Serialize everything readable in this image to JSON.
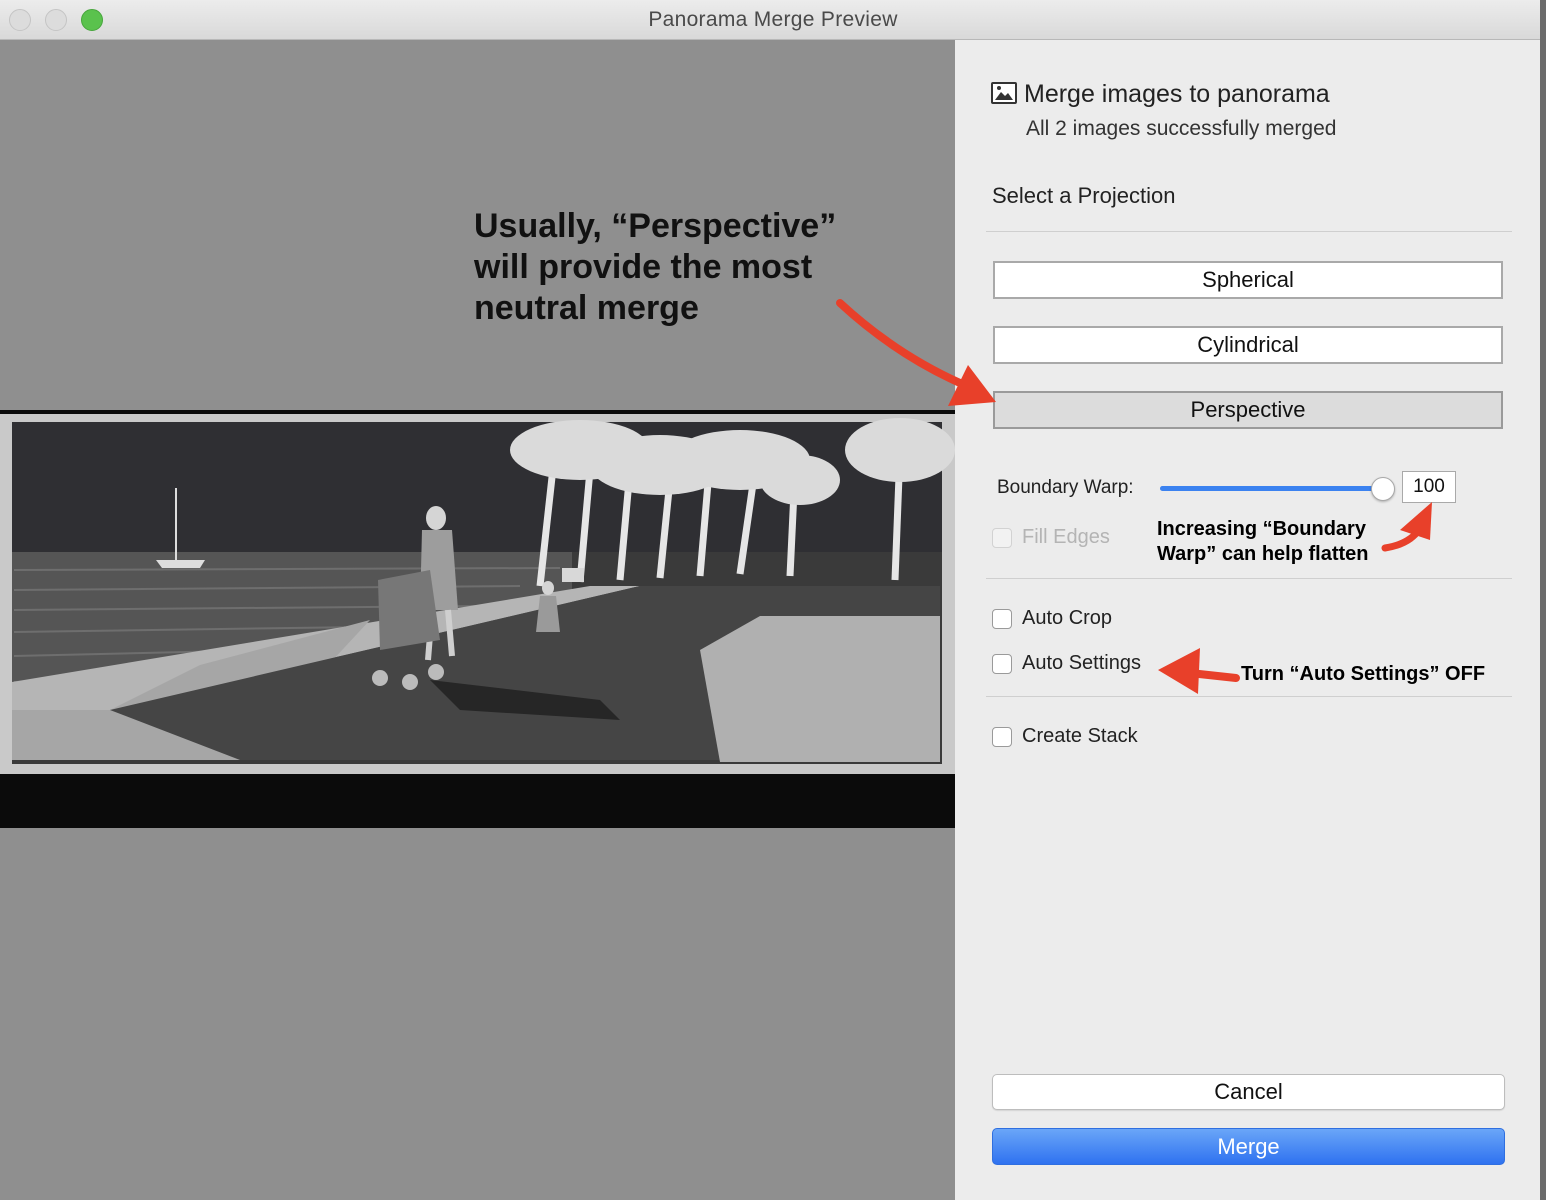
{
  "window": {
    "title": "Panorama Merge Preview"
  },
  "header": {
    "title": "Merge images to panorama",
    "subtitle": "All 2 images successfully merged"
  },
  "projection": {
    "section_label": "Select a Projection",
    "options": [
      "Spherical",
      "Cylindrical",
      "Perspective"
    ],
    "selected": "Perspective"
  },
  "boundary_warp": {
    "label": "Boundary Warp:",
    "value": "100",
    "level": 100,
    "max": 100
  },
  "checkboxes": {
    "fill_edges": {
      "label": "Fill Edges",
      "checked": false,
      "enabled": false
    },
    "auto_crop": {
      "label": "Auto Crop",
      "checked": false,
      "enabled": true
    },
    "auto_settings": {
      "label": "Auto Settings",
      "checked": false,
      "enabled": true
    },
    "create_stack": {
      "label": "Create Stack",
      "checked": false,
      "enabled": true
    }
  },
  "buttons": {
    "cancel": "Cancel",
    "merge": "Merge"
  },
  "annotations": {
    "perspective_line1": "Usually, “Perspective”",
    "perspective_line2": "will provide the most",
    "perspective_line3": "neutral merge",
    "boundary_line1": "Increasing “Boundary",
    "boundary_line2": "Warp” can help flatten",
    "auto_settings": "Turn “Auto Settings” OFF"
  },
  "colors": {
    "accent": "#3b82f0",
    "annotation_arrow": "#e8402a",
    "merge_button": "#2f72f0"
  }
}
